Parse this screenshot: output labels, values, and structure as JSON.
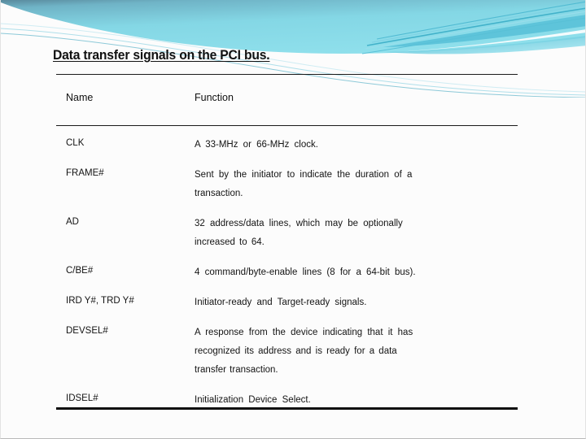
{
  "slide": {
    "title": "Data transfer signals on the PCI bus.",
    "accent_color": "#7fdbe8",
    "banner_dark": "#5d8c9e",
    "banner_light": "#8fe3ef",
    "rule_color": "#111111",
    "background": "#fcfcfc"
  },
  "table": {
    "headers": {
      "name": "Name",
      "function": "Function"
    },
    "rows": [
      {
        "name": "CLK",
        "function_lines": [
          "A  33-MHz   or  66-MHz    clock."
        ]
      },
      {
        "name": "FRAME#",
        "function_lines": [
          "Sent  by  the  initiator   to  indicate   the  duration   of  a",
          "transaction."
        ]
      },
      {
        "name": "AD",
        "function_lines": [
          "32  address/data   lines,   which    may  be optionally",
          "increased   to  64."
        ]
      },
      {
        "name": "C/BE#",
        "function_lines": [
          "4 command/byte-enable     lines  (8  for  a 64-bit   bus)."
        ]
      },
      {
        "name": "IRD Y#,   TRD Y#",
        "function_lines": [
          "Initiator-ready    and     Target-ready signals."
        ]
      },
      {
        "name": "DEVSEL#",
        "function_lines": [
          "A  response  from   the  device  indicating   that   it  has",
          "recognized   its  address  and  is  ready   for   a  data",
          "transfer  transaction."
        ]
      },
      {
        "name": "IDSEL#",
        "function_lines": [
          "Initialization       Device   Select."
        ]
      }
    ]
  }
}
